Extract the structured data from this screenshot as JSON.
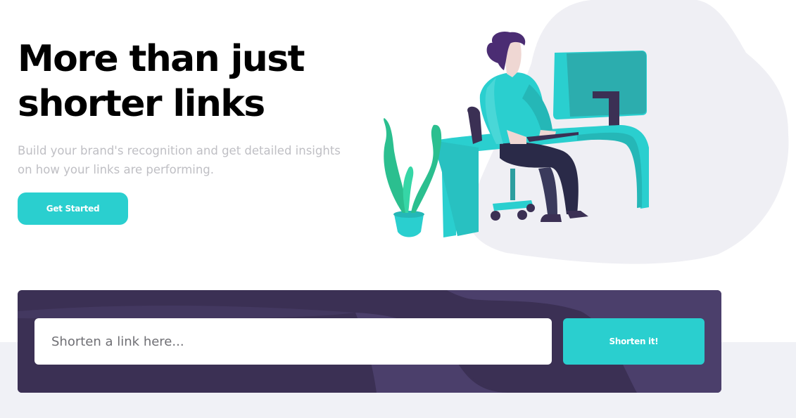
{
  "hero": {
    "title_line1": "More than just",
    "title_line2": "shorter links",
    "subtitle": "Build your brand's recognition and get detailed insights on how your links are performing.",
    "cta_label": "Get Started"
  },
  "shortener": {
    "input_placeholder": "Shorten a link here...",
    "input_value": "",
    "button_label": "Shorten it!"
  },
  "illustration": {
    "name": "person-working-at-desk-illustration"
  },
  "colors": {
    "accent": "#2acfcf",
    "panel": "#3b3054",
    "panel_wave": "#4b3f6b",
    "title": "#000000",
    "subtitle": "#bfbfc4",
    "band": "#f0f1f6",
    "blob": "#efeff4"
  }
}
